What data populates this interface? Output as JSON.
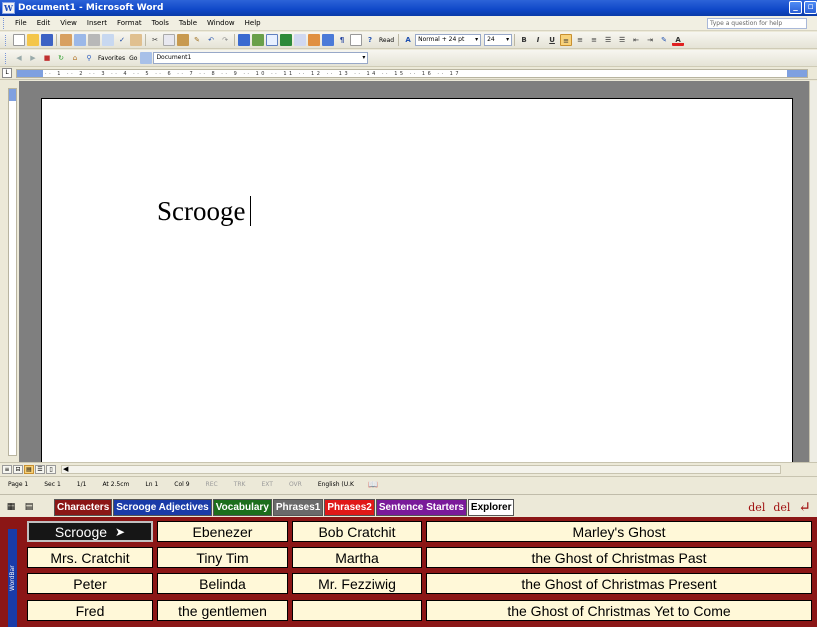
{
  "window": {
    "title": "Document1 - Microsoft Word",
    "icon": "word-icon"
  },
  "menubar": {
    "items": [
      "File",
      "Edit",
      "View",
      "Insert",
      "Format",
      "Tools",
      "Table",
      "Window",
      "Help"
    ],
    "question_placeholder": "Type a question for help"
  },
  "toolbar": {
    "read_label": "Read",
    "style_value": "Normal + 24 pt",
    "size_value": "24",
    "bold": "B",
    "italic": "I",
    "underline": "U",
    "favorites_label": "Favorites",
    "go_label": "Go",
    "address_value": "Document1"
  },
  "document": {
    "text": "Scrooge"
  },
  "status": {
    "page": "Page 1",
    "sec": "Sec 1",
    "pages": "1/1",
    "at": "At 2.5cm",
    "ln": "Ln 1",
    "col": "Col 9",
    "rec": "REC",
    "trk": "TRK",
    "ext": "EXT",
    "ovr": "OVR",
    "language": "English (U.K"
  },
  "wordbar": {
    "side_label": "WordBar",
    "tabs": [
      {
        "label": "Characters",
        "bg": "#8b1616",
        "fg": "#ffffff"
      },
      {
        "label": "Scrooge Adjectives",
        "bg": "#1a3ba8",
        "fg": "#ffffff"
      },
      {
        "label": "Vocabulary",
        "bg": "#1c6e1c",
        "fg": "#ffffff"
      },
      {
        "label": "Phrases1",
        "bg": "#6a6a6a",
        "fg": "#ffffff"
      },
      {
        "label": "Phrases2",
        "bg": "#e01818",
        "fg": "#ffffff"
      },
      {
        "label": "Sentence Starters",
        "bg": "#7a1a9a",
        "fg": "#ffffff"
      },
      {
        "label": "Explorer",
        "bg": "#ffffff",
        "fg": "#000000"
      }
    ],
    "actions": {
      "del_word": "del",
      "del_letter": "del",
      "enter": "↵"
    },
    "grid": [
      [
        "Scrooge",
        "Ebenezer",
        "Bob Cratchit",
        "Marley's Ghost"
      ],
      [
        "Mrs. Cratchit",
        "Tiny Tim",
        "Martha",
        "the Ghost of Christmas Past"
      ],
      [
        "Peter",
        "Belinda",
        "Mr. Fezziwig",
        "the Ghost of Christmas Present"
      ],
      [
        "Fred",
        "the gentlemen",
        "",
        "the Ghost of Christmas Yet to Come"
      ]
    ],
    "selected": "Scrooge"
  }
}
